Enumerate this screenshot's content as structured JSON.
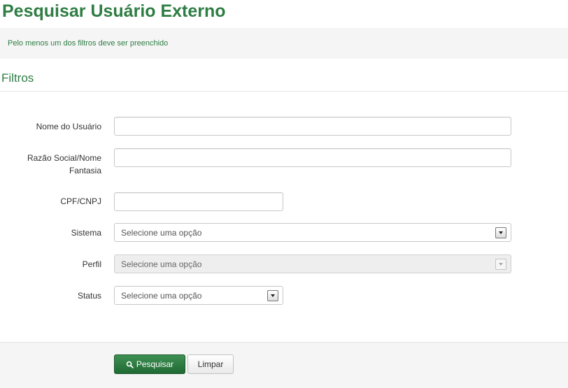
{
  "page": {
    "title": "Pesquisar Usuário Externo"
  },
  "alert": {
    "message": "Pelo menos um dos filtros deve ser preenchido"
  },
  "filters": {
    "section_title": "Filtros",
    "nome_usuario": {
      "label": "Nome do Usuário",
      "value": ""
    },
    "razao_social": {
      "label": "Razão Social/Nome Fantasia",
      "value": ""
    },
    "cpf_cnpj": {
      "label": "CPF/CNPJ",
      "value": ""
    },
    "sistema": {
      "label": "Sistema",
      "selected": "Selecione uma opção",
      "disabled": false
    },
    "perfil": {
      "label": "Perfil",
      "selected": "Selecione uma opção",
      "disabled": true
    },
    "status": {
      "label": "Status",
      "selected": "Selecione uma opção",
      "disabled": false
    }
  },
  "actions": {
    "search_label": "Pesquisar",
    "clear_label": "Limpar",
    "search_icon": "search-icon"
  },
  "colors": {
    "accent_green": "#2e7d43",
    "primary_button": "#2d7a42"
  }
}
